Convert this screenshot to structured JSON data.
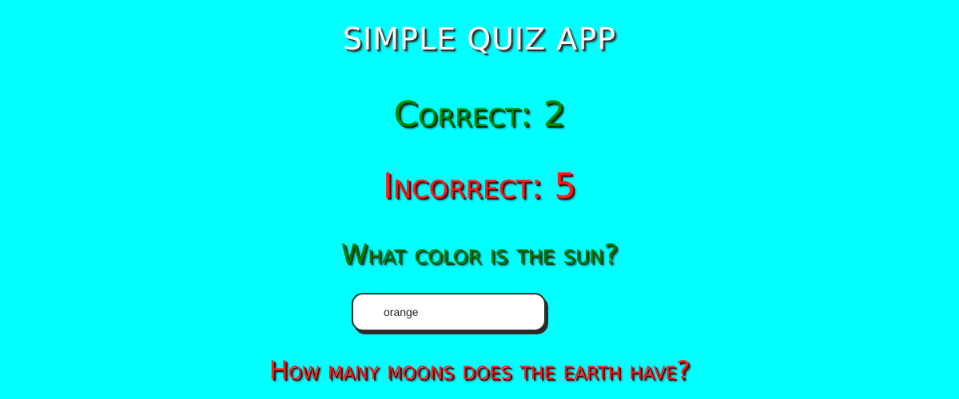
{
  "app": {
    "title": "SIMPLE QUIZ APP"
  },
  "scores": {
    "correct_label": "Correct: 2",
    "incorrect_label": "Incorrect: 5"
  },
  "questions": [
    {
      "text": "What color is the sun?",
      "answer_value": "orange"
    },
    {
      "text": "How many moons does the earth have?"
    }
  ],
  "colors": {
    "background": "#00FFFF",
    "title": "#FFFFFF",
    "correct": "#008800",
    "incorrect": "#FF1A1A",
    "question_1": "#007A00",
    "question_2": "#FF1A1A"
  }
}
